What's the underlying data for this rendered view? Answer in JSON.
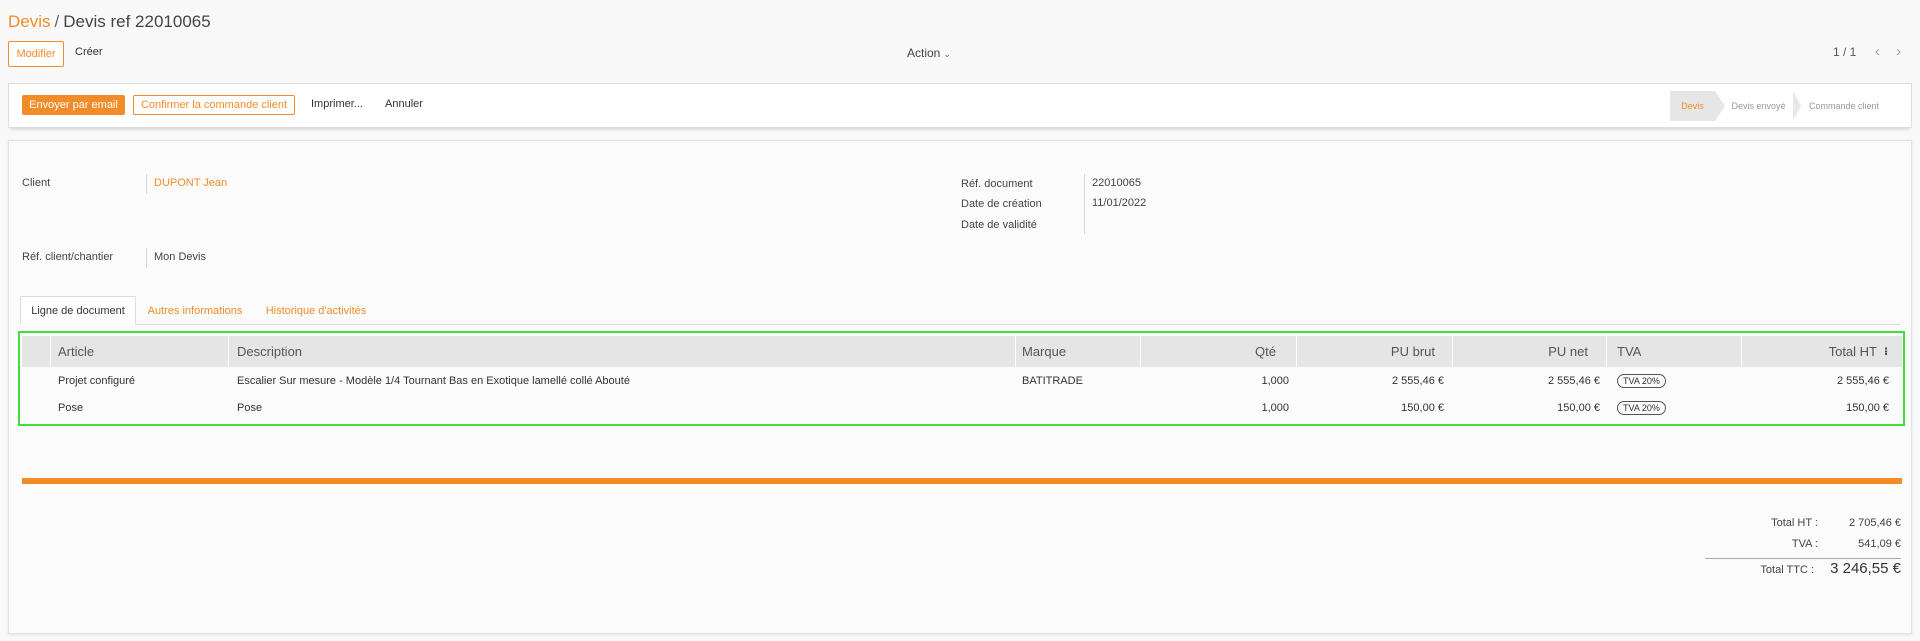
{
  "breadcrumb": {
    "parent": "Devis",
    "separator": "/",
    "current": "Devis ref 22010065"
  },
  "control": {
    "edit_label": "Modifier",
    "create_label": "Créer",
    "action_label": "Action",
    "pager": "1 / 1"
  },
  "header_buttons": {
    "send_email": "Envoyer par email",
    "confirm_order": "Confirmer la commande client",
    "print": "Imprimer...",
    "cancel": "Annuler"
  },
  "statusbar": {
    "stages": [
      "Devis",
      "Devis envoyé",
      "Commande client"
    ],
    "active": "Devis"
  },
  "fields": {
    "client_label": "Client",
    "client_value": "DUPONT Jean",
    "ref_client_label": "Réf. client/chantier",
    "ref_client_value": "Mon Devis",
    "ref_doc_label": "Réf. document",
    "ref_doc_value": "22010065",
    "date_creation_label": "Date de création",
    "date_creation_value": "11/01/2022",
    "date_validite_label": "Date de validité",
    "date_validite_value": ""
  },
  "tabs": [
    "Ligne de document",
    "Autres informations",
    "Historique d'activités"
  ],
  "table": {
    "headers": {
      "article": "Article",
      "description": "Description",
      "marque": "Marque",
      "qte": "Qté",
      "pu_brut": "PU brut",
      "pu_net": "PU net",
      "tva": "TVA",
      "total_ht": "Total HT"
    },
    "rows": [
      {
        "article": "Projet configuré",
        "description": "Escalier Sur mesure - Modèle 1/4 Tournant Bas en Exotique lamellé collé Abouté",
        "marque": "BATITRADE",
        "qte": "1,000",
        "pu_brut": "2 555,46 €",
        "pu_net": "2 555,46 €",
        "tva": "TVA 20%",
        "total_ht": "2 555,46 €"
      },
      {
        "article": "Pose",
        "description": "Pose",
        "marque": "",
        "qte": "1,000",
        "pu_brut": "150,00 €",
        "pu_net": "150,00 €",
        "tva": "TVA 20%",
        "total_ht": "150,00 €"
      }
    ]
  },
  "totals": {
    "ht_label": "Total HT :",
    "ht_value": "2 705,46 €",
    "tva_label": "TVA :",
    "tva_value": "541,09 €",
    "ttc_label": "Total TTC :",
    "ttc_value": "3 246,55 €"
  },
  "colors": {
    "accent": "#f28c28",
    "highlight_border": "#3ee03e",
    "header_bg": "#e5e5e5"
  }
}
